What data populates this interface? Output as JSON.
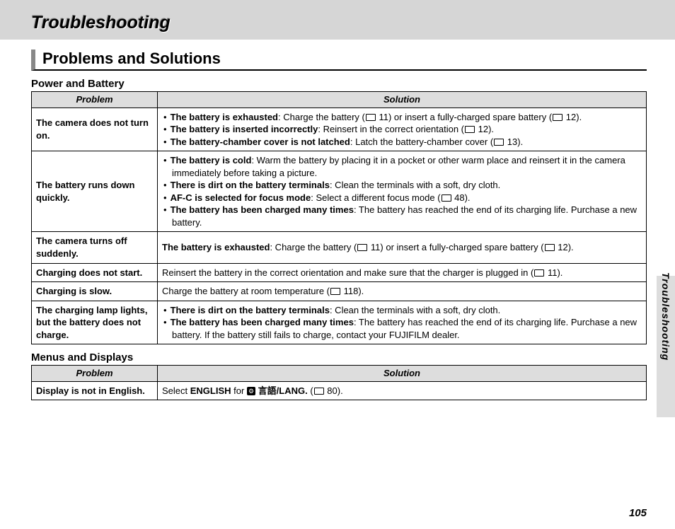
{
  "chapter_title": "Troubleshooting",
  "section_title": "Problems and Solutions",
  "side_label": "Troubleshooting",
  "page_number": "105",
  "tables": [
    {
      "caption": "Power and Battery",
      "headers": {
        "problem": "Problem",
        "solution": "Solution"
      },
      "rows": [
        {
          "problem": "The camera does not turn on.",
          "bullets": [
            {
              "lead": "The battery is exhausted",
              "text": ": Charge the battery (",
              "ref": "11",
              "tail": ") or insert a fully-charged spare battery (",
              "ref2": "12",
              "tail2": ")."
            },
            {
              "lead": "The battery is inserted incorrectly",
              "text": ": Reinsert in the correct orientation (",
              "ref": "12",
              "tail": ")."
            },
            {
              "lead": "The battery-chamber cover is not latched",
              "text": ": Latch the battery-chamber cover (",
              "ref": "13",
              "tail": ")."
            }
          ]
        },
        {
          "problem": "The battery runs down quickly.",
          "bullets": [
            {
              "lead": "The battery is cold",
              "text": ": Warm the battery by placing it in a pocket or other warm place and reinsert it in the camera immediately before taking a picture."
            },
            {
              "lead": "There is dirt on the battery terminals",
              "text": ": Clean the terminals with a soft, dry cloth."
            },
            {
              "lead": "AF-C is selected for focus mode",
              "text": ": Select a different focus mode (",
              "ref": "48",
              "tail": ")."
            },
            {
              "lead": "The battery has been charged many times",
              "text": ": The battery has reached the end of its charging life.  Purchase a new battery."
            }
          ]
        },
        {
          "problem": "The camera turns off suddenly.",
          "plain": {
            "lead": "The battery is exhausted",
            "text": ": Charge the battery (",
            "ref": "11",
            "tail": ") or insert a fully-charged spare battery (",
            "ref2": "12",
            "tail2": ")."
          }
        },
        {
          "problem": "Charging does not start.",
          "plain": {
            "text": "Reinsert the battery in the correct orientation and make sure that the charger is plugged in (",
            "ref": "11",
            "tail": ")."
          }
        },
        {
          "problem": "Charging is slow.",
          "plain": {
            "text": "Charge the battery at room temperature (",
            "ref": "118",
            "tail": ")."
          }
        },
        {
          "problem": "The charging lamp lights, but the battery does not charge.",
          "bullets": [
            {
              "lead": "There is dirt on the battery terminals",
              "text": ": Clean the terminals with a soft, dry cloth."
            },
            {
              "lead": "The battery has been charged many times",
              "text": ": The battery has reached the end of its charging life.  Purchase a new battery.  If the battery still fails to charge, contact your FUJIFILM dealer."
            }
          ]
        }
      ]
    },
    {
      "caption": "Menus and Displays",
      "headers": {
        "problem": "Problem",
        "solution": "Solution"
      },
      "rows": [
        {
          "problem": "Display is not in English.",
          "lang_row": {
            "pre": "Select ",
            "bold": "ENGLISH",
            "mid": " for ",
            "lang_label": "言語/LANG.",
            "post": " (",
            "ref": "80",
            "tail": ")."
          }
        }
      ]
    }
  ]
}
